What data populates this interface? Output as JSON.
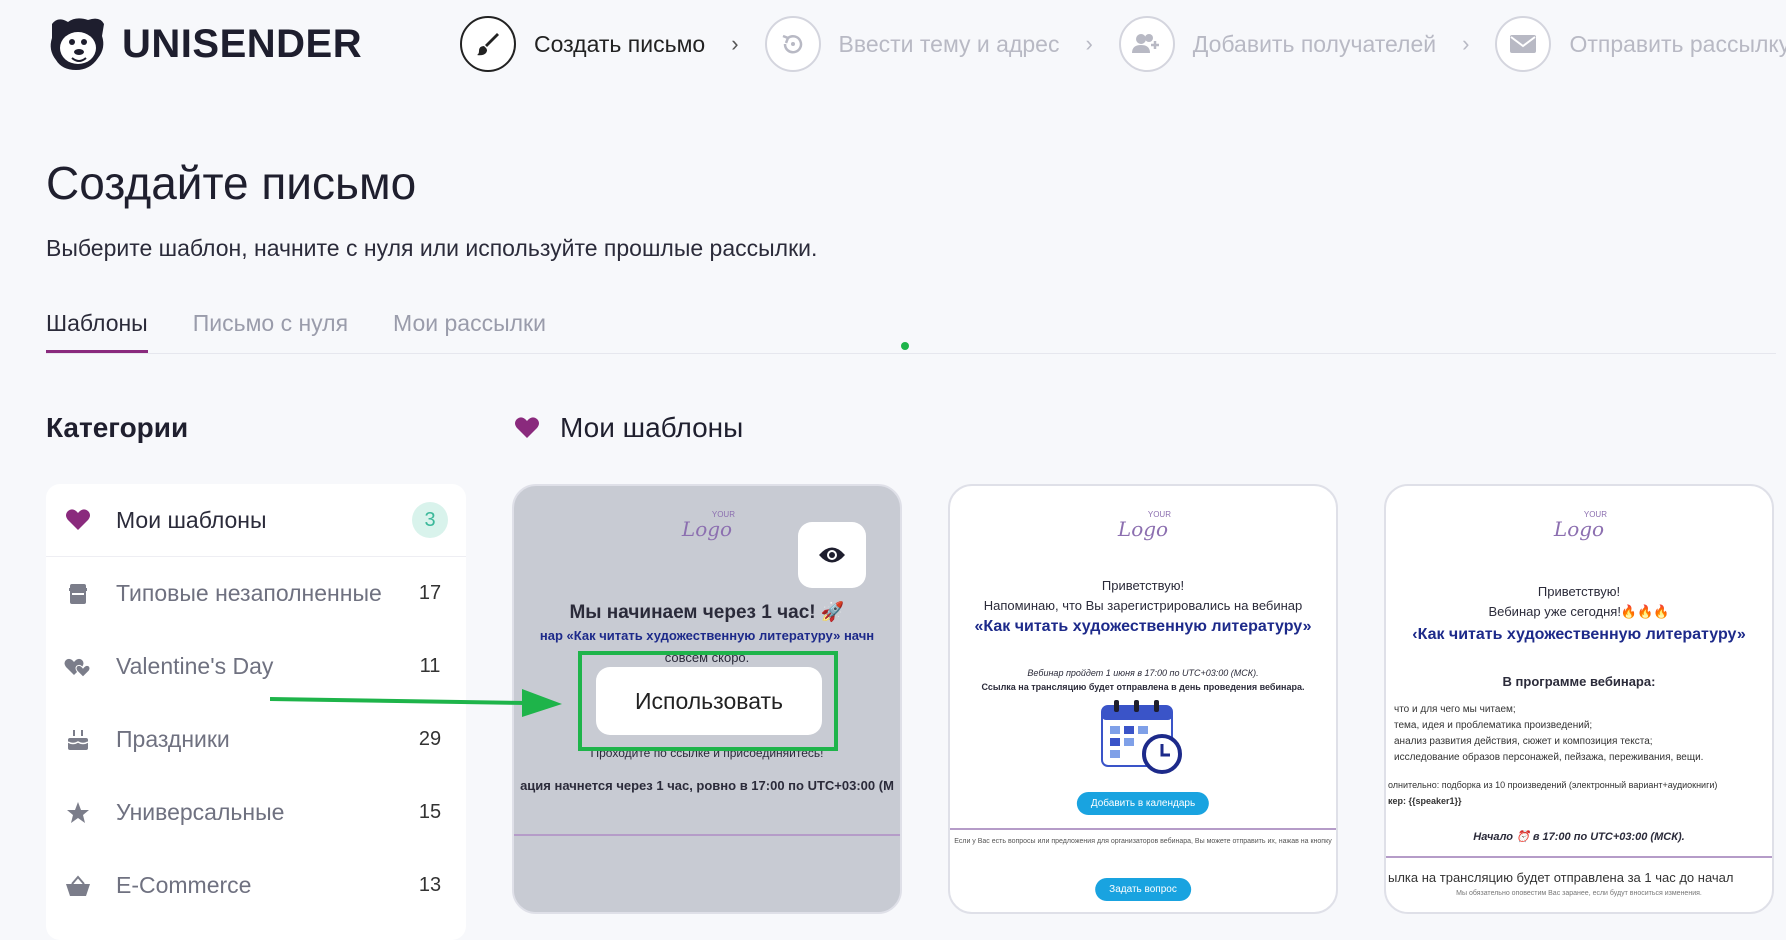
{
  "brand": {
    "name": "UNISENDER"
  },
  "steps": [
    {
      "label": "Создать письмо",
      "icon": "brush-icon",
      "active": true
    },
    {
      "label": "Ввести тему и адрес",
      "icon": "refresh-icon",
      "active": false
    },
    {
      "label": "Добавить получателей",
      "icon": "add-users-icon",
      "active": false
    },
    {
      "label": "Отправить рассылку",
      "icon": "envelope-icon",
      "active": false
    }
  ],
  "page": {
    "title": "Создайте письмо",
    "subtitle": "Выберите шаблон, начните с нуля или используйте прошлые рассылки."
  },
  "tabs": [
    {
      "label": "Шаблоны",
      "active": true
    },
    {
      "label": "Письмо с нуля",
      "active": false
    },
    {
      "label": "Мои рассылки",
      "active": false
    }
  ],
  "categories": {
    "title": "Категории",
    "items": [
      {
        "label": "Мои шаблоны",
        "count": "3",
        "icon": "heart-icon",
        "active": true
      },
      {
        "label": "Типовые незаполненные",
        "count": "17",
        "icon": "document-icon",
        "active": false
      },
      {
        "label": "Valentine's Day",
        "count": "11",
        "icon": "hearts-icon",
        "active": false
      },
      {
        "label": "Праздники",
        "count": "29",
        "icon": "cake-icon",
        "active": false
      },
      {
        "label": "Универсальные",
        "count": "15",
        "icon": "star-icon",
        "active": false
      },
      {
        "label": "E-Commerce",
        "count": "13",
        "icon": "basket-icon",
        "active": false
      }
    ]
  },
  "templates": {
    "title": "Мои шаблоны",
    "use_label": "Использовать",
    "logo_text": "Logo",
    "logo_small": "YOUR",
    "card1": {
      "heading": "Мы начинаем через 1 час! 🚀",
      "line1": "нар «Как читать художественную литературу» начн",
      "line2": "совсем скоро.",
      "line3": "Проходите по ссылке и присоединяйтесь!",
      "line4": "ация начнется через 1 час, ровно в 17:00 по UTC+03:00 (М"
    },
    "card2": {
      "greet": "Приветствую!",
      "line1": "Напоминаю, что Вы зарегистрировались на вебинар",
      "title": "«Как читать художественную литературу»",
      "line2": "Вебинар пройдет 1 июня в 17:00 по UTC+03:00 (МСК).",
      "line3": "Ссылка на трансляцию будет отправлена в день проведения вебинара.",
      "calendar_btn": "Добавить в календарь",
      "footer": "Если у Вас есть вопросы или предложения для организаторов вебинара, Вы можете отправить их, нажав на кнопку",
      "ask_btn": "Задать вопрос"
    },
    "card3": {
      "greet": "Приветствую!",
      "line1": "Вебинар уже сегодня!🔥🔥🔥",
      "title": "‹Как читать художественную литературу»",
      "program": "В программе вебинара:",
      "items": [
        "что и для чего мы читаем;",
        "тема, идея и проблематика произведений;",
        "анализ развития действия, сюжет и композиция текста;",
        "исследование образов персонажей, пейзажа, переживания, вещи."
      ],
      "extra": "олнительно: подборка из 10 произведений (электронный вариант+аудиокниги)",
      "speaker": "кер: {{speaker1}}",
      "start": "Начало ⏰ в 17:00 по UTC+03:00 (МСК).",
      "link": "ылка на трансляцию будет отправлена за 1 час до начал",
      "note": "Мы обязательно оповестим Вас заранее, если будут вноситься изменения."
    }
  },
  "colors": {
    "accent": "#8a2a7d",
    "green": "#1eb44a",
    "count_bg": "#d9f3ec"
  }
}
